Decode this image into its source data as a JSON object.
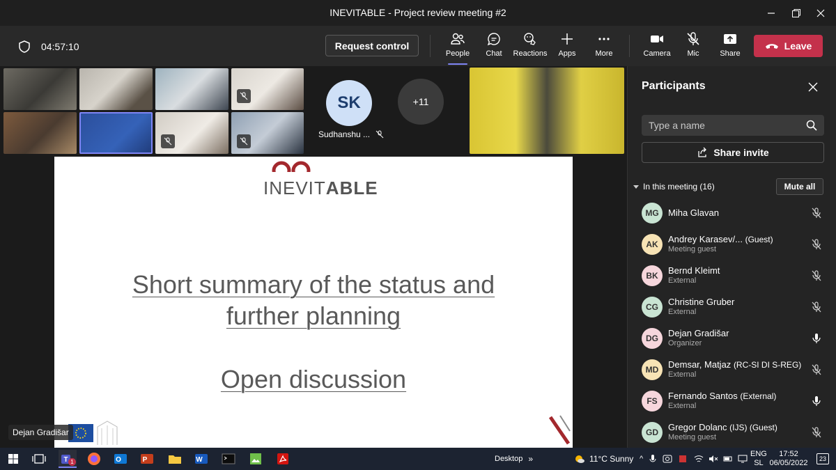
{
  "window": {
    "title": "INEVITABLE - Project review meeting #2"
  },
  "toolbar": {
    "timer": "04:57:10",
    "request_control": "Request control",
    "buttons": {
      "people": "People",
      "chat": "Chat",
      "reactions": "Reactions",
      "apps": "Apps",
      "more": "More",
      "camera": "Camera",
      "mic": "Mic",
      "share": "Share"
    },
    "leave": "Leave",
    "accent": "#7f85f5",
    "leave_color": "#c4314b"
  },
  "stage": {
    "avatar_initials": "SK",
    "avatar_name": "Sudhanshu ...",
    "overflow_count": "+11",
    "presenter_badge": "Dejan Gradišar"
  },
  "slide": {
    "logo_light": "INEVIT",
    "logo_bold": "ABLE",
    "line1": "Short summary of the status and",
    "line2": "further planning",
    "line3": "Open discussion"
  },
  "panel": {
    "title": "Participants",
    "search_placeholder": "Type a name",
    "share_invite": "Share invite",
    "section_label": "In this meeting (16)",
    "mute_all": "Mute all",
    "participants": [
      {
        "initials": "MG",
        "name": "Miha Glavan",
        "tag": "",
        "role": "",
        "mic": "off",
        "color": "#c9e4d3"
      },
      {
        "initials": "AK",
        "name": "Andrey Karasev/...",
        "tag": "(Guest)",
        "role": "Meeting guest",
        "mic": "off",
        "color": "#f7e3b5"
      },
      {
        "initials": "BK",
        "name": "Bernd Kleimt",
        "tag": "",
        "role": "External",
        "mic": "off",
        "color": "#f6d6dc"
      },
      {
        "initials": "CG",
        "name": "Christine Gruber",
        "tag": "",
        "role": "External",
        "mic": "off",
        "color": "#c9e4d3"
      },
      {
        "initials": "DG",
        "name": "Dejan Gradišar",
        "tag": "",
        "role": "Organizer",
        "mic": "on",
        "color": "#f6d6dc"
      },
      {
        "initials": "MD",
        "name": "Demsar, Matjaz",
        "tag": "(RC-SI DI S-REG)",
        "role": "External",
        "mic": "off",
        "color": "#f7e3b5"
      },
      {
        "initials": "FS",
        "name": "Fernando Santos",
        "tag": "(External)",
        "role": "External",
        "mic": "on",
        "color": "#f6d6dc"
      },
      {
        "initials": "GD",
        "name": "Gregor Dolanc",
        "tag": "(IJS) (Guest)",
        "role": "Meeting guest",
        "mic": "off",
        "color": "#c9e4d3"
      }
    ]
  },
  "taskbar": {
    "desktop_label": "Desktop",
    "weather": "11°C  Sunny",
    "lang_top": "ENG",
    "lang_bottom": "SL",
    "time": "17:52",
    "date": "06/05/2022",
    "notif_count": "23",
    "teams_badge": "1"
  }
}
